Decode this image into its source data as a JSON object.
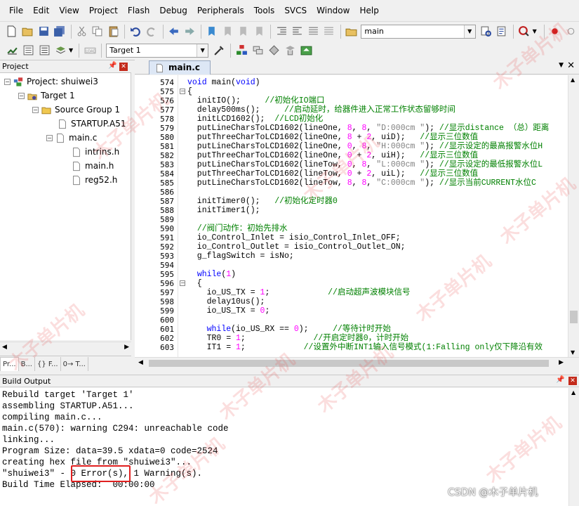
{
  "menu": [
    "File",
    "Edit",
    "View",
    "Project",
    "Flash",
    "Debug",
    "Peripherals",
    "Tools",
    "SVCS",
    "Window",
    "Help"
  ],
  "toolbar": {
    "search_combo": "main",
    "target_combo": "Target 1"
  },
  "project_panel": {
    "title": "Project",
    "tree": {
      "project": "Project: shuiwei3",
      "target": "Target 1",
      "group": "Source Group 1",
      "files": [
        "STARTUP.A51",
        "main.c"
      ],
      "includes": [
        "intrins.h",
        "main.h",
        "reg52.h"
      ]
    },
    "tabs": [
      "Pr...",
      "B...",
      "{} F...",
      "0→ T..."
    ]
  },
  "editor": {
    "tab": "main.c",
    "lines": [
      {
        "n": "574",
        "t": "void main(void)"
      },
      {
        "n": "575",
        "t": "{",
        "fold": "−"
      },
      {
        "n": "576",
        "t": "  initIO();     //初始化IO端口"
      },
      {
        "n": "577",
        "t": "  delay500ms();     //启动延时，给器件进入正常工作状态留够时间"
      },
      {
        "n": "578",
        "t": "  initLCD1602();  //LCD初始化"
      },
      {
        "n": "579",
        "t": "  putLineCharsToLCD1602(lineOne, 8, 8, \"D:000cm \"); //显示distance （总）距离"
      },
      {
        "n": "580",
        "t": "  putThreeCharToLCD1602(lineOne, 8 + 2, uiD);   //显示三位数值"
      },
      {
        "n": "581",
        "t": "  putLineCharsToLCD1602(lineOne, 0, 8, \"H:000cm \"); //显示设定的最高报警水位H"
      },
      {
        "n": "582",
        "t": "  putThreeCharToLCD1602(lineOne, 0 + 2, uiH);   //显示三位数值"
      },
      {
        "n": "583",
        "t": "  putLineCharsToLCD1602(lineTow, 0, 8, \"L:000cm \"); //显示设定的最低报警水位L"
      },
      {
        "n": "584",
        "t": "  putThreeCharToLCD1602(lineTow, 0 + 2, uiL);   //显示三位数值"
      },
      {
        "n": "585",
        "t": "  putLineCharsToLCD1602(lineTow, 8, 8, \"C:000cm \"); //显示当前CURRENT水位C"
      },
      {
        "n": "586",
        "t": ""
      },
      {
        "n": "587",
        "t": "  initTimer0();   //初始化定时器0"
      },
      {
        "n": "588",
        "t": "  initTimer1();"
      },
      {
        "n": "589",
        "t": ""
      },
      {
        "n": "590",
        "t": "  //阀门动作：初始先排水"
      },
      {
        "n": "591",
        "t": "  io_Control_Inlet = isio_Control_Inlet_OFF;"
      },
      {
        "n": "592",
        "t": "  io_Control_Outlet = isio_Control_Outlet_ON;"
      },
      {
        "n": "593",
        "t": "  g_flagSwitch = isNo;"
      },
      {
        "n": "594",
        "t": ""
      },
      {
        "n": "595",
        "t": "  while(1)"
      },
      {
        "n": "596",
        "t": "  {",
        "fold": "−"
      },
      {
        "n": "597",
        "t": "    io_US_TX = 1;            //启动超声波模块信号"
      },
      {
        "n": "598",
        "t": "    delay10us();"
      },
      {
        "n": "599",
        "t": "    io_US_TX = 0;"
      },
      {
        "n": "600",
        "t": ""
      },
      {
        "n": "601",
        "t": "    while(io_US_RX == 0);     //等待计时开始"
      },
      {
        "n": "602",
        "t": "    TR0 = 1;              //开启定时器0，计时开始"
      },
      {
        "n": "603",
        "t": "    IT1 = 1;            //设置外中断INT1输入信号模式(1:Falling only仅下降沿有效"
      }
    ]
  },
  "build_output": {
    "title": "Build Output",
    "lines": [
      "Rebuild target 'Target 1'",
      "assembling STARTUP.A51...",
      "compiling main.c...",
      "main.c(570): warning C294: unreachable code",
      "linking...",
      "Program Size: data=39.5 xdata=0 code=2524",
      "creating hex file from \"shuiwei3\"...",
      "\"shuiwei3\" - 0 Error(s), 1 Warning(s).",
      "Build Time Elapsed:  00:00:00"
    ]
  },
  "watermark": "木子单片机",
  "credit": "CSDN @木子单片机"
}
